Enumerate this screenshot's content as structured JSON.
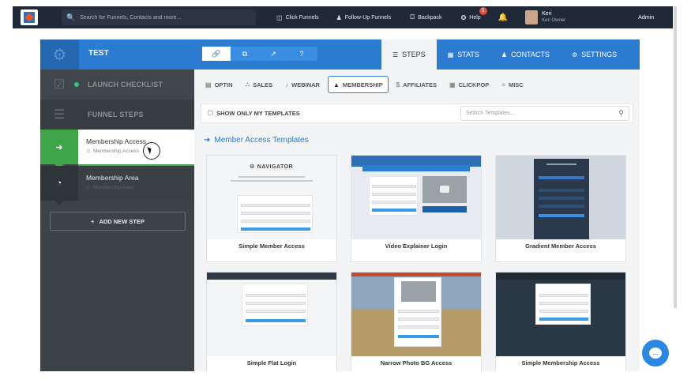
{
  "topnav": {
    "search_placeholder": "Search for Funnels, Contacts and more...",
    "links": [
      "Click Funnels",
      "Follow-Up Funnels",
      "Backpack",
      "Help"
    ],
    "help_badge": "5",
    "user_name": "Keri",
    "user_role": "Keri  Owner",
    "admin": "Admin"
  },
  "funnel": {
    "name": "TEST"
  },
  "toptabs": [
    "STEPS",
    "STATS",
    "CONTACTS",
    "SETTINGS"
  ],
  "sidebar": {
    "launch_checklist": "LAUNCH CHECKLIST",
    "funnel_steps": "FUNNEL STEPS",
    "steps": [
      {
        "title": "Membership Access",
        "subtitle": "Membership Access"
      },
      {
        "title": "Membership Area",
        "subtitle": "Membership Area"
      }
    ],
    "add_step": "ADD NEW STEP"
  },
  "categories": [
    "OPTIN",
    "SALES",
    "WEBINAR",
    "MEMBERSHIP",
    "AFFILIATES",
    "CLICKPOP",
    "MISC"
  ],
  "filter": {
    "show_only_mine": "SHOW ONLY MY TEMPLATES",
    "search_placeholder": "Search Templates..."
  },
  "section_title": "Member Access Templates",
  "templates": [
    {
      "name": "Simple Member Access"
    },
    {
      "name": "Video Explainer Login"
    },
    {
      "name": "Gradient Member Access"
    },
    {
      "name": "Simple Flat Login"
    },
    {
      "name": "Narrow Photo BG Access"
    },
    {
      "name": "Simple Membership Access"
    }
  ],
  "thumbnails": {
    "navigator": "NAVIGATOR"
  },
  "colors": {
    "accent": "#2b7bd0",
    "success": "#3fa54b",
    "sidebar": "#3d4246",
    "topnav": "#1f2937"
  }
}
